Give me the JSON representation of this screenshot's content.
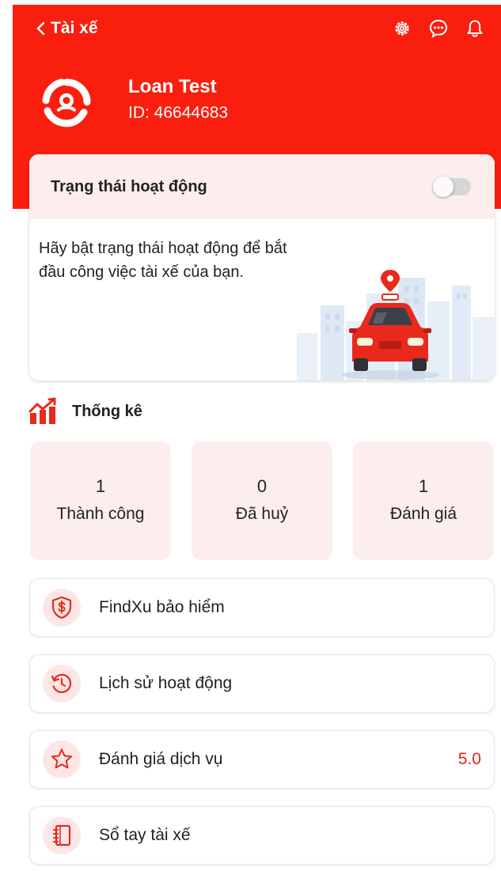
{
  "header": {
    "back_label": "Tài xế",
    "icons": [
      "settings-icon",
      "chat-icon",
      "bell-icon"
    ],
    "user_name": "Loan Test",
    "user_id": "ID: 46644683"
  },
  "status_card": {
    "title": "Trạng thái hoạt động",
    "toggle_on": false,
    "description": "Hãy bật trạng thái hoạt động để bắt đầu công việc tài xế của bạn."
  },
  "stats": {
    "title": "Thống kê",
    "items": [
      {
        "value": "1",
        "label": "Thành công"
      },
      {
        "value": "0",
        "label": "Đã huỷ"
      },
      {
        "value": "1",
        "label": "Đánh giá"
      }
    ]
  },
  "menu": {
    "items": [
      {
        "label": "FindXu bảo hiểm",
        "icon": "shield-dollar-icon",
        "value": ""
      },
      {
        "label": "Lịch sử hoạt động",
        "icon": "history-icon",
        "value": ""
      },
      {
        "label": "Đánh giá dịch vụ",
        "icon": "star-icon",
        "value": "5.0"
      },
      {
        "label": "Sổ tay tài xế",
        "icon": "notebook-icon",
        "value": ""
      }
    ]
  },
  "colors": {
    "primary": "#fa1e0e",
    "light_pink": "#fdeeee",
    "accent_value": "#e0261a"
  }
}
